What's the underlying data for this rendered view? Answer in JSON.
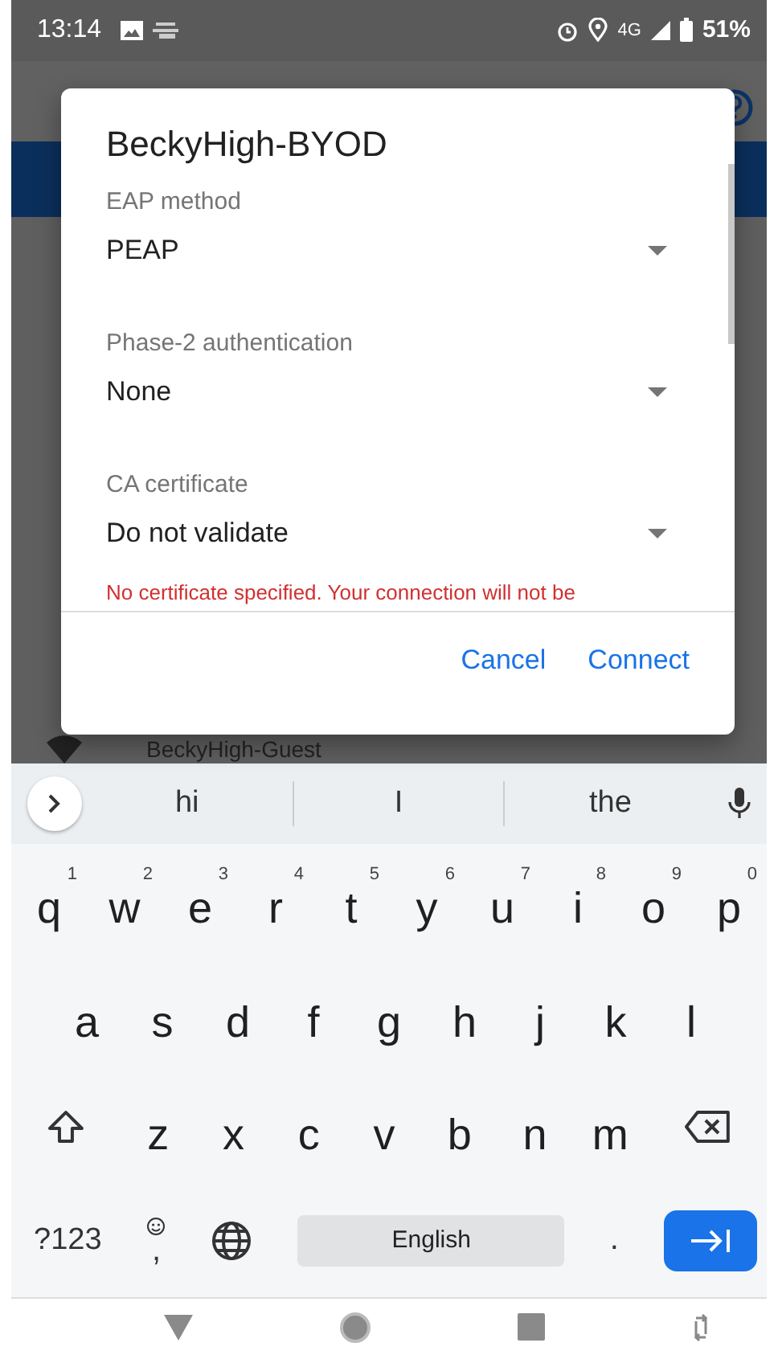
{
  "status_bar": {
    "time": "13:14",
    "network": "4G",
    "battery": "51%"
  },
  "background_list": {
    "items": [
      "BeckyHigh-Guest"
    ]
  },
  "dialog": {
    "title": "BeckyHigh-BYOD",
    "fields": [
      {
        "label": "EAP method",
        "value": "PEAP"
      },
      {
        "label": "Phase-2 authentication",
        "value": "None"
      },
      {
        "label": "CA certificate",
        "value": "Do not validate"
      }
    ],
    "warning": "No certificate specified. Your connection will not be",
    "buttons": [
      "Cancel",
      "Connect"
    ]
  },
  "keyboard": {
    "suggestions": [
      "hi",
      "I",
      "the"
    ],
    "rows": [
      [
        {
          "key": "q",
          "hint": "1"
        },
        {
          "key": "w",
          "hint": "2"
        },
        {
          "key": "e",
          "hint": "3"
        },
        {
          "key": "r",
          "hint": "4"
        },
        {
          "key": "t",
          "hint": "5"
        },
        {
          "key": "y",
          "hint": "6"
        },
        {
          "key": "u",
          "hint": "7"
        },
        {
          "key": "i",
          "hint": "8"
        },
        {
          "key": "o",
          "hint": "9"
        },
        {
          "key": "p",
          "hint": "0"
        }
      ],
      [
        {
          "key": "a"
        },
        {
          "key": "s"
        },
        {
          "key": "d"
        },
        {
          "key": "f"
        },
        {
          "key": "g"
        },
        {
          "key": "h"
        },
        {
          "key": "j"
        },
        {
          "key": "k"
        },
        {
          "key": "l"
        }
      ],
      [
        {
          "key": "z"
        },
        {
          "key": "x"
        },
        {
          "key": "c"
        },
        {
          "key": "v"
        },
        {
          "key": "b"
        },
        {
          "key": "n"
        },
        {
          "key": "m"
        }
      ]
    ],
    "symbols": "?123",
    "comma": ",",
    "space": "English",
    "period": "."
  }
}
